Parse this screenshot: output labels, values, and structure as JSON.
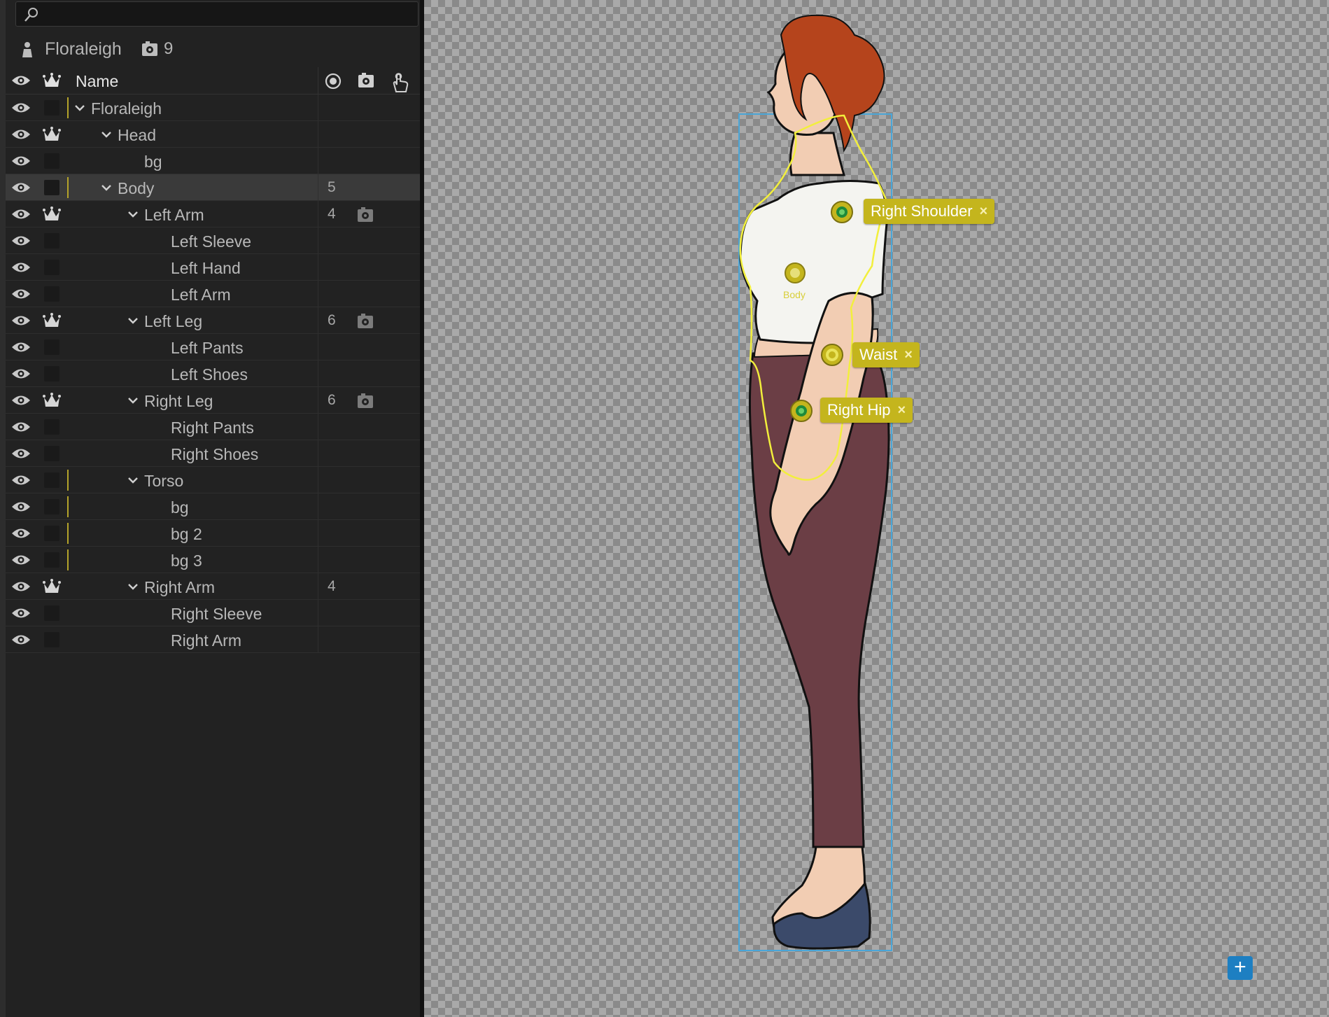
{
  "search": {
    "placeholder": "",
    "value": ""
  },
  "puppet": {
    "name": "Floraleigh",
    "group_count": "9"
  },
  "columns": {
    "name": "Name"
  },
  "rows": [
    {
      "name": "Floraleigh",
      "crown": false,
      "expanded": true,
      "level": 0,
      "tag": true,
      "count": "",
      "cam": false,
      "selected": false
    },
    {
      "name": "Head",
      "crown": true,
      "expanded": true,
      "level": 1,
      "tag": false,
      "count": "",
      "cam": false,
      "selected": false
    },
    {
      "name": "bg",
      "crown": false,
      "expanded": null,
      "level": 2,
      "tag": false,
      "count": "",
      "cam": false,
      "selected": false
    },
    {
      "name": "Body",
      "crown": false,
      "expanded": true,
      "level": 1,
      "tag": true,
      "count": "5",
      "cam": false,
      "selected": true
    },
    {
      "name": "Left Arm",
      "crown": true,
      "expanded": true,
      "level": 2,
      "tag": false,
      "count": "4",
      "cam": true,
      "selected": false
    },
    {
      "name": "Left Sleeve",
      "crown": false,
      "expanded": null,
      "level": 3,
      "tag": false,
      "count": "",
      "cam": false,
      "selected": false
    },
    {
      "name": "Left Hand",
      "crown": false,
      "expanded": null,
      "level": 3,
      "tag": false,
      "count": "",
      "cam": false,
      "selected": false
    },
    {
      "name": "Left Arm",
      "crown": false,
      "expanded": null,
      "level": 3,
      "tag": false,
      "count": "",
      "cam": false,
      "selected": false
    },
    {
      "name": "Left Leg",
      "crown": true,
      "expanded": true,
      "level": 2,
      "tag": false,
      "count": "6",
      "cam": true,
      "selected": false
    },
    {
      "name": "Left Pants",
      "crown": false,
      "expanded": null,
      "level": 3,
      "tag": false,
      "count": "",
      "cam": false,
      "selected": false
    },
    {
      "name": "Left Shoes",
      "crown": false,
      "expanded": null,
      "level": 3,
      "tag": false,
      "count": "",
      "cam": false,
      "selected": false
    },
    {
      "name": "Right Leg",
      "crown": true,
      "expanded": true,
      "level": 2,
      "tag": false,
      "count": "6",
      "cam": true,
      "selected": false
    },
    {
      "name": "Right Pants",
      "crown": false,
      "expanded": null,
      "level": 3,
      "tag": false,
      "count": "",
      "cam": false,
      "selected": false
    },
    {
      "name": "Right Shoes",
      "crown": false,
      "expanded": null,
      "level": 3,
      "tag": false,
      "count": "",
      "cam": false,
      "selected": false
    },
    {
      "name": "Torso",
      "crown": false,
      "expanded": true,
      "level": 2,
      "tag": true,
      "count": "",
      "cam": false,
      "selected": false
    },
    {
      "name": "bg",
      "crown": false,
      "expanded": null,
      "level": 3,
      "tag": true,
      "count": "",
      "cam": false,
      "selected": false
    },
    {
      "name": "bg 2",
      "crown": false,
      "expanded": null,
      "level": 3,
      "tag": true,
      "count": "",
      "cam": false,
      "selected": false
    },
    {
      "name": "bg 3",
      "crown": false,
      "expanded": null,
      "level": 3,
      "tag": true,
      "count": "",
      "cam": false,
      "selected": false
    },
    {
      "name": "Right Arm",
      "crown": true,
      "expanded": true,
      "level": 2,
      "tag": false,
      "count": "4",
      "cam": false,
      "selected": false
    },
    {
      "name": "Right Sleeve",
      "crown": false,
      "expanded": null,
      "level": 3,
      "tag": false,
      "count": "",
      "cam": false,
      "selected": false
    },
    {
      "name": "Right Arm",
      "crown": false,
      "expanded": null,
      "level": 3,
      "tag": false,
      "count": "",
      "cam": false,
      "selected": false
    }
  ],
  "canvas": {
    "handles": [
      {
        "label": "Right Shoulder",
        "close": "×"
      },
      {
        "label": "Waist",
        "close": "×"
      },
      {
        "label": "Right Hip",
        "close": "×"
      }
    ],
    "origin_label": "Body",
    "add_label": "+"
  },
  "colors": {
    "handle_yellow": "#c4b51d",
    "bounds_blue": "#4aa6d8",
    "add_button": "#1d7fc2",
    "hair": "#b5441c",
    "pants": "#6b3e45",
    "shoes": "#3b4a6a",
    "skin": "#f2cdb3",
    "blouse": "#f4f4f0"
  },
  "icons": [
    "search-icon",
    "person-icon",
    "camera-gear-icon",
    "eye-icon",
    "crown-icon",
    "origin-target-icon",
    "hand-grab-icon",
    "chevron-down-icon"
  ]
}
